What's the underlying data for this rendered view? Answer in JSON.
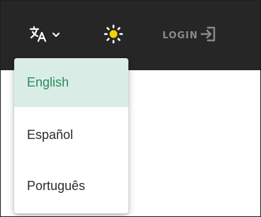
{
  "header": {
    "login_label": "LOGIN"
  },
  "icons": {
    "language": "translate-icon",
    "language_caret": "chevron-down-icon",
    "theme": "sun-icon",
    "login": "login-icon"
  },
  "language_menu": {
    "selected": "English",
    "items": [
      {
        "label": "English"
      },
      {
        "label": "Español"
      },
      {
        "label": "Português"
      }
    ]
  },
  "colors": {
    "topbar": "#262626",
    "icon_light": "#ffffff",
    "muted": "#8a8a8a",
    "selected_bg": "#d9ede6",
    "selected_text": "#2e8a62",
    "sun": "#f2d400"
  }
}
